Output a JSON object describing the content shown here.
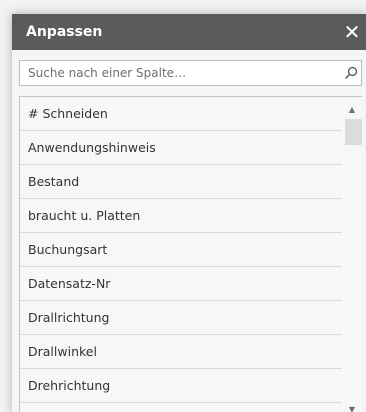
{
  "panel": {
    "title": "Anpassen",
    "close_glyph": "✕"
  },
  "search": {
    "placeholder": "Suche nach einer Spalte…",
    "value": "",
    "icon": "search-icon"
  },
  "columns": {
    "items": [
      {
        "label": "# Schneiden"
      },
      {
        "label": "Anwendungshinweis"
      },
      {
        "label": "Bestand"
      },
      {
        "label": "braucht u. Platten"
      },
      {
        "label": "Buchungsart"
      },
      {
        "label": "Datensatz-Nr"
      },
      {
        "label": "Drallrichtung"
      },
      {
        "label": "Drallwinkel"
      },
      {
        "label": "Drehrichtung"
      }
    ]
  },
  "scrollbar": {
    "up_glyph": "▲",
    "down_glyph": "▼"
  },
  "colors": {
    "titlebar": "#5b5b5b",
    "panel_bg": "#f5f5f5",
    "row_border": "#d9d9d9",
    "text": "#333333"
  }
}
